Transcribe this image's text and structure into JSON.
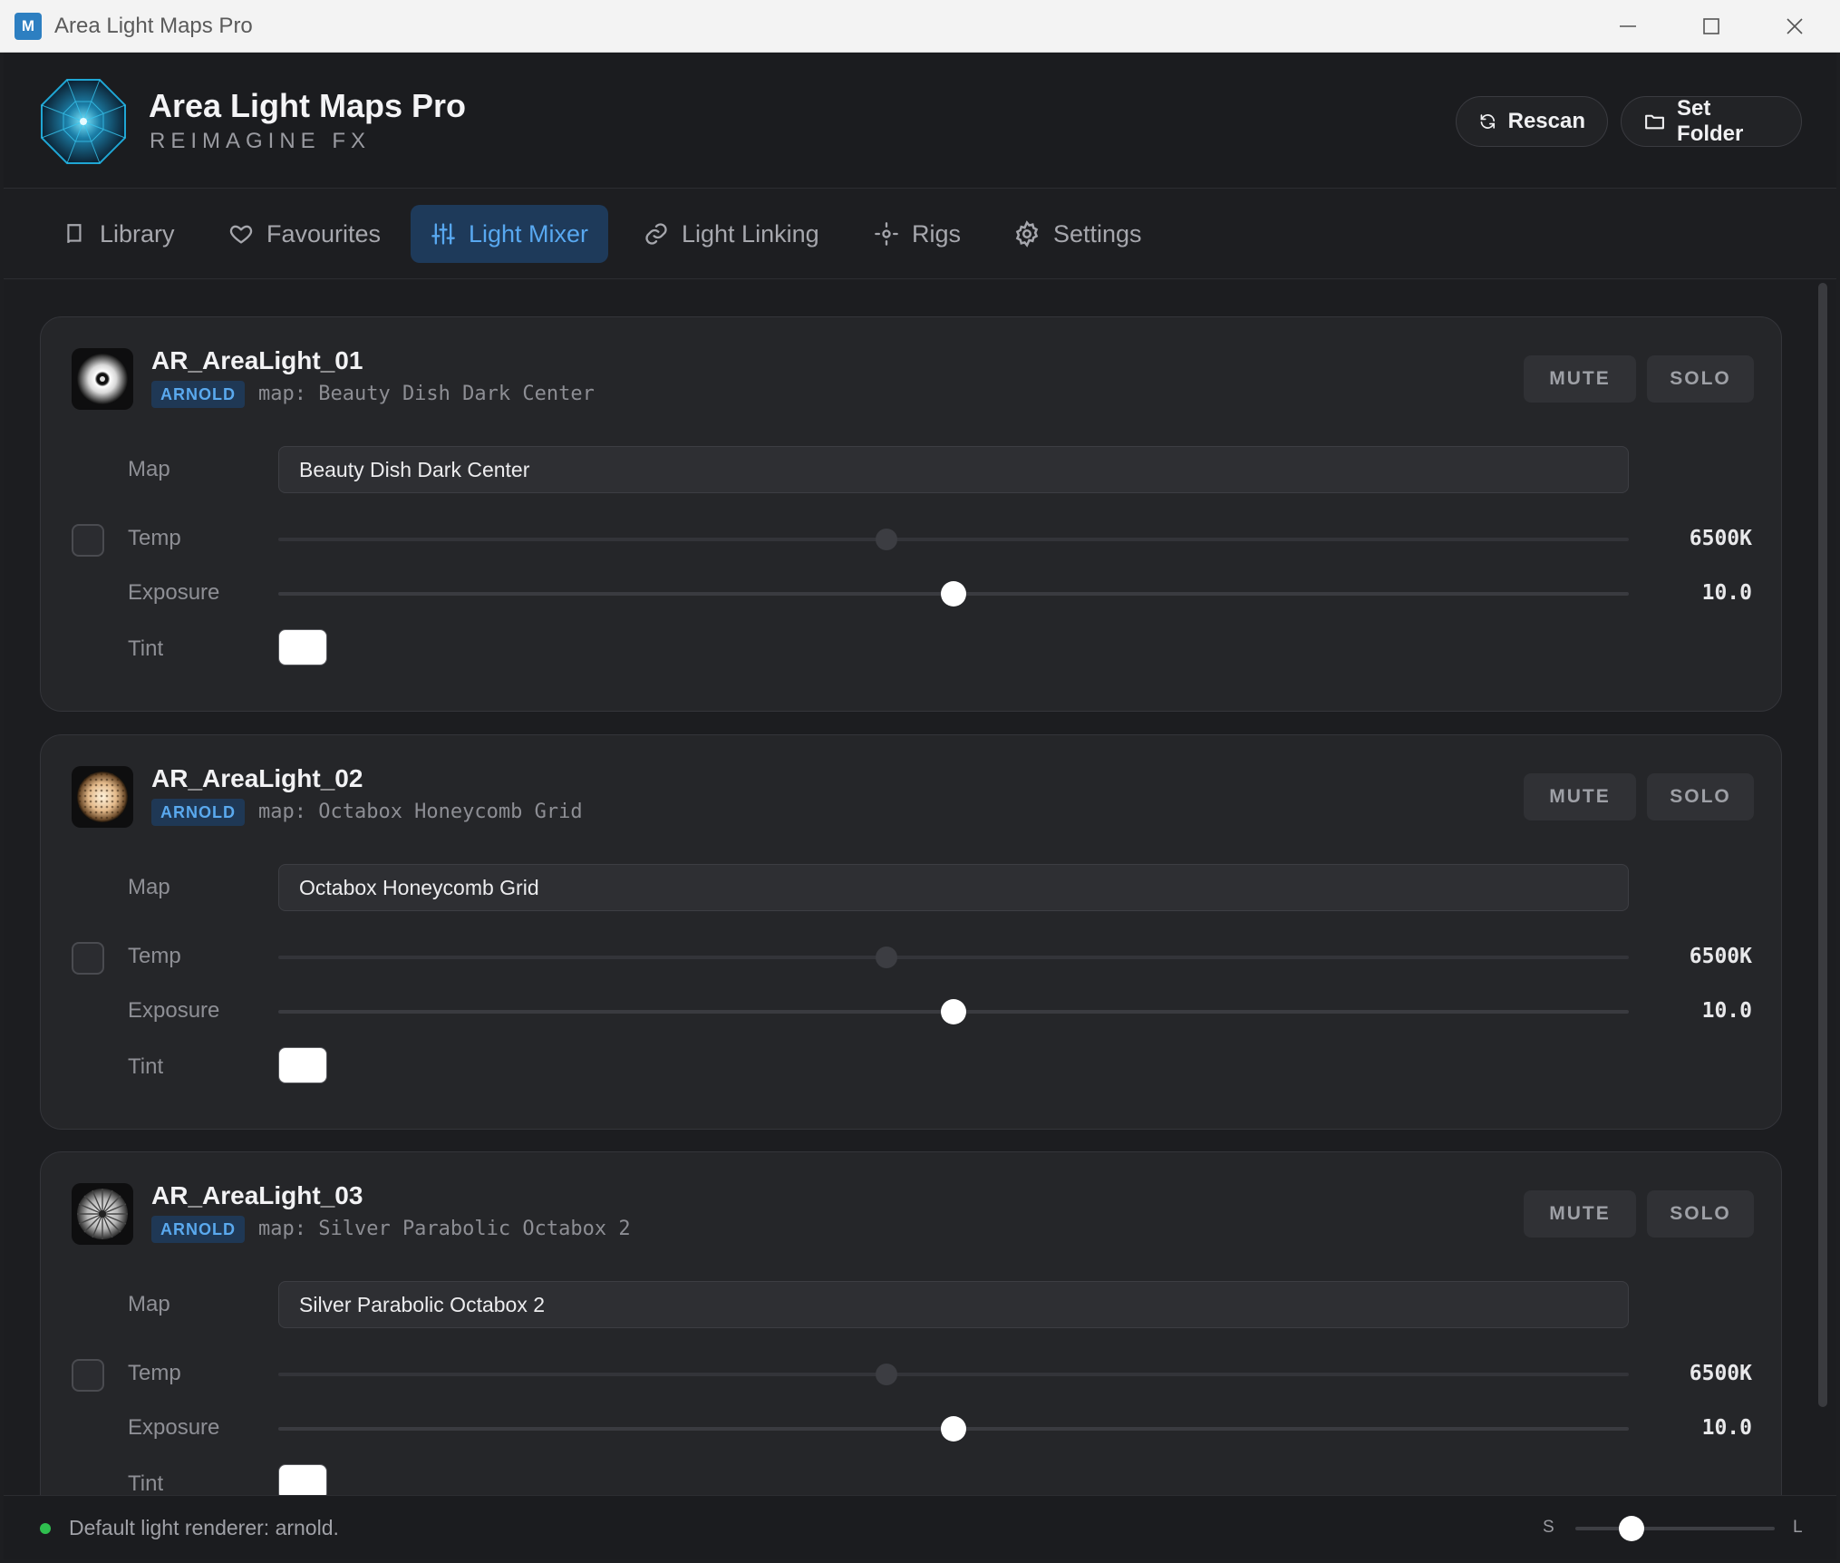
{
  "window": {
    "title": "Area Light Maps Pro",
    "app_icon": "M"
  },
  "header": {
    "title": "Area Light Maps Pro",
    "subtitle": "REIMAGINE FX",
    "rescan_label": "Rescan",
    "set_folder_label": "Set Folder"
  },
  "tabs": [
    {
      "label": "Library",
      "icon": "book-icon"
    },
    {
      "label": "Favourites",
      "icon": "heart-icon"
    },
    {
      "label": "Light Mixer",
      "icon": "sliders-icon",
      "active": true
    },
    {
      "label": "Light Linking",
      "icon": "link-icon"
    },
    {
      "label": "Rigs",
      "icon": "sun-icon"
    },
    {
      "label": "Settings",
      "icon": "gear-icon"
    }
  ],
  "row_labels": {
    "map": "Map",
    "temp": "Temp",
    "exposure": "Exposure",
    "tint": "Tint"
  },
  "buttons": {
    "mute": "MUTE",
    "solo": "SOLO"
  },
  "lights": [
    {
      "name": "AR_AreaLight_01",
      "renderer": "ARNOLD",
      "map_line": "map: Beauty Dish Dark Center",
      "map": "Beauty Dish Dark Center",
      "temp_label": "6500K",
      "temp_pos": 0.45,
      "exposure_label": "10.0",
      "exposure_pos": 0.5,
      "tint_color": "#ffffff",
      "thumb": "beauty-dish"
    },
    {
      "name": "AR_AreaLight_02",
      "renderer": "ARNOLD",
      "map_line": "map: Octabox Honeycomb Grid",
      "map": "Octabox Honeycomb Grid",
      "temp_label": "6500K",
      "temp_pos": 0.45,
      "exposure_label": "10.0",
      "exposure_pos": 0.5,
      "tint_color": "#ffffff",
      "thumb": "honeycomb"
    },
    {
      "name": "AR_AreaLight_03",
      "renderer": "ARNOLD",
      "map_line": "map: Silver Parabolic Octabox 2",
      "map": "Silver Parabolic Octabox 2",
      "temp_label": "6500K",
      "temp_pos": 0.45,
      "exposure_label": "10.0",
      "exposure_pos": 0.5,
      "tint_color": "#ffffff",
      "thumb": "parabolic"
    }
  ],
  "status": {
    "text": "Default light renderer: arnold.",
    "indicator_color": "#2fbf4f",
    "size_small": "S",
    "size_large": "L",
    "thumb_size_pos": 0.28
  },
  "colors": {
    "accent": "#58a8f0",
    "badge_bg": "#1f3855"
  }
}
